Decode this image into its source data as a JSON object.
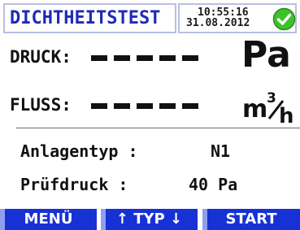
{
  "header": {
    "title": "DICHTHEITSTEST",
    "time": "10:55:16",
    "date": "31.08.2012",
    "status_icon": "check-circle-icon",
    "status_color": "#3ec22a"
  },
  "measurements": {
    "pressure": {
      "label": "DRUCK:",
      "value_display": "-----",
      "unit": "Pa"
    },
    "flow": {
      "label": "FLUSS:",
      "value_display": "-----",
      "unit": "m³/h",
      "unit_base": "m",
      "unit_exp": "3",
      "unit_den": "h"
    }
  },
  "info": {
    "anlagentyp": {
      "label": "Anlagentyp :",
      "value": "N1"
    },
    "pruefdruck": {
      "label": "Prüfdruck  :",
      "value": "40 Pa"
    }
  },
  "softkeys": {
    "menu": "MENÜ",
    "typ": "↑ TYP ↓",
    "start": "START"
  },
  "colors": {
    "accent_blue": "#1631d4",
    "title_blue": "#1e2bb6",
    "frame": "#b9bfe2"
  }
}
